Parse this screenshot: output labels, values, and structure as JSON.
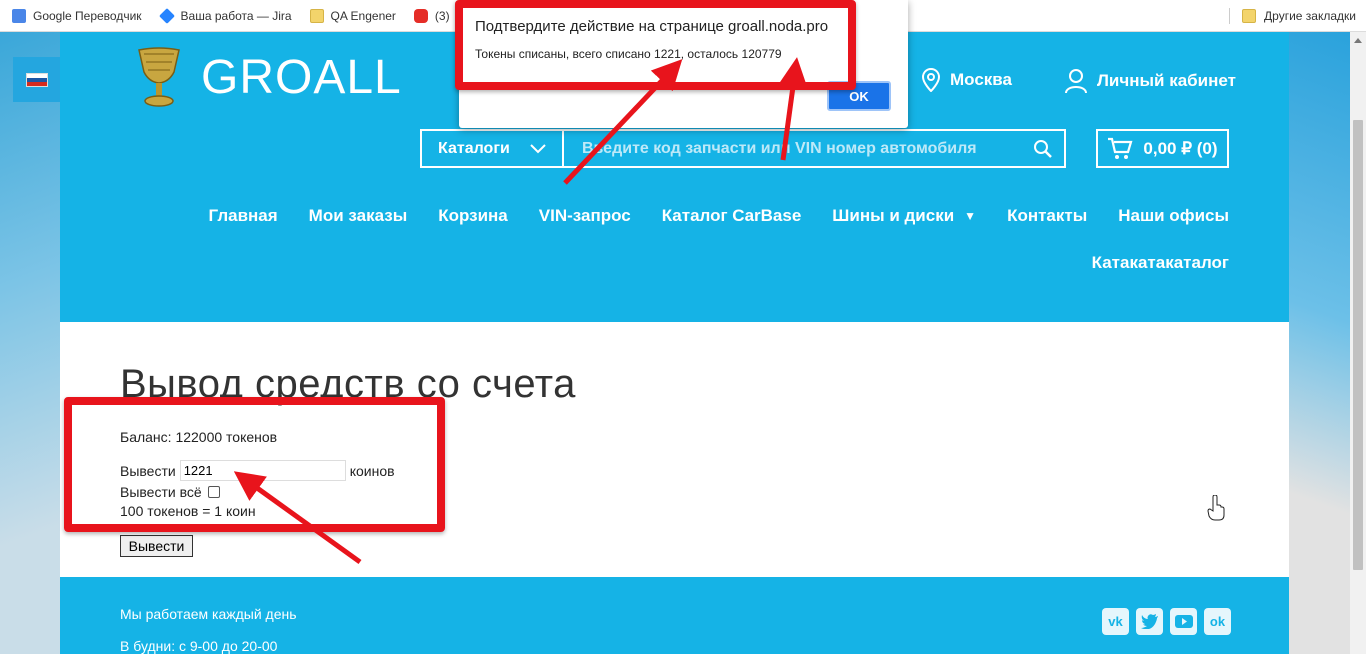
{
  "bookmarks": {
    "items": [
      {
        "label": "Google Переводчик",
        "icon": "google-translate-icon"
      },
      {
        "label": "Ваша работа — Jira",
        "icon": "jira-icon"
      },
      {
        "label": "QA Engener",
        "icon": "folder-icon"
      },
      {
        "label": "(3)",
        "icon": "youtube-icon"
      }
    ],
    "other": "Другие закладки"
  },
  "header": {
    "logo_text": "GROALL",
    "city": "Москва",
    "cabinet": "Личный кабинет",
    "catalogs_label": "Каталоги",
    "search_placeholder": "Введите код запчасти или VIN номер автомобиля",
    "cart": "0,00 ₽ (0)"
  },
  "nav": {
    "items": [
      "Главная",
      "Мои заказы",
      "Корзина",
      "VIN-запрос",
      "Каталог CarBase",
      "Шины и диски",
      "Контакты",
      "Наши офисы"
    ],
    "second_row": "Катакатакаталог"
  },
  "main": {
    "title": "Вывод средств со счета",
    "balance": "Баланс: 122000 токенов",
    "withdraw_label": "Вывести",
    "withdraw_value": "1221",
    "withdraw_unit": "коинов",
    "withdraw_all_label": "Вывести всё",
    "rate": "100 токенов = 1 коин",
    "submit": "Вывести"
  },
  "footer": {
    "line1": "Мы работаем каждый день",
    "line2": "В будни: с 9-00 до 20-00",
    "socials": [
      "vk-icon",
      "twitter-icon",
      "youtube-icon",
      "odnoklassniki-icon"
    ]
  },
  "dialog": {
    "title": "Подтвердите действие на странице groall.noda.pro",
    "message": "Токены списаны, всего списано 1221, осталось 120779",
    "ok": "OK"
  },
  "colors": {
    "brand_blue": "#15b3e6",
    "annotation_red": "#e8141c",
    "dialog_button": "#1a73e8"
  }
}
